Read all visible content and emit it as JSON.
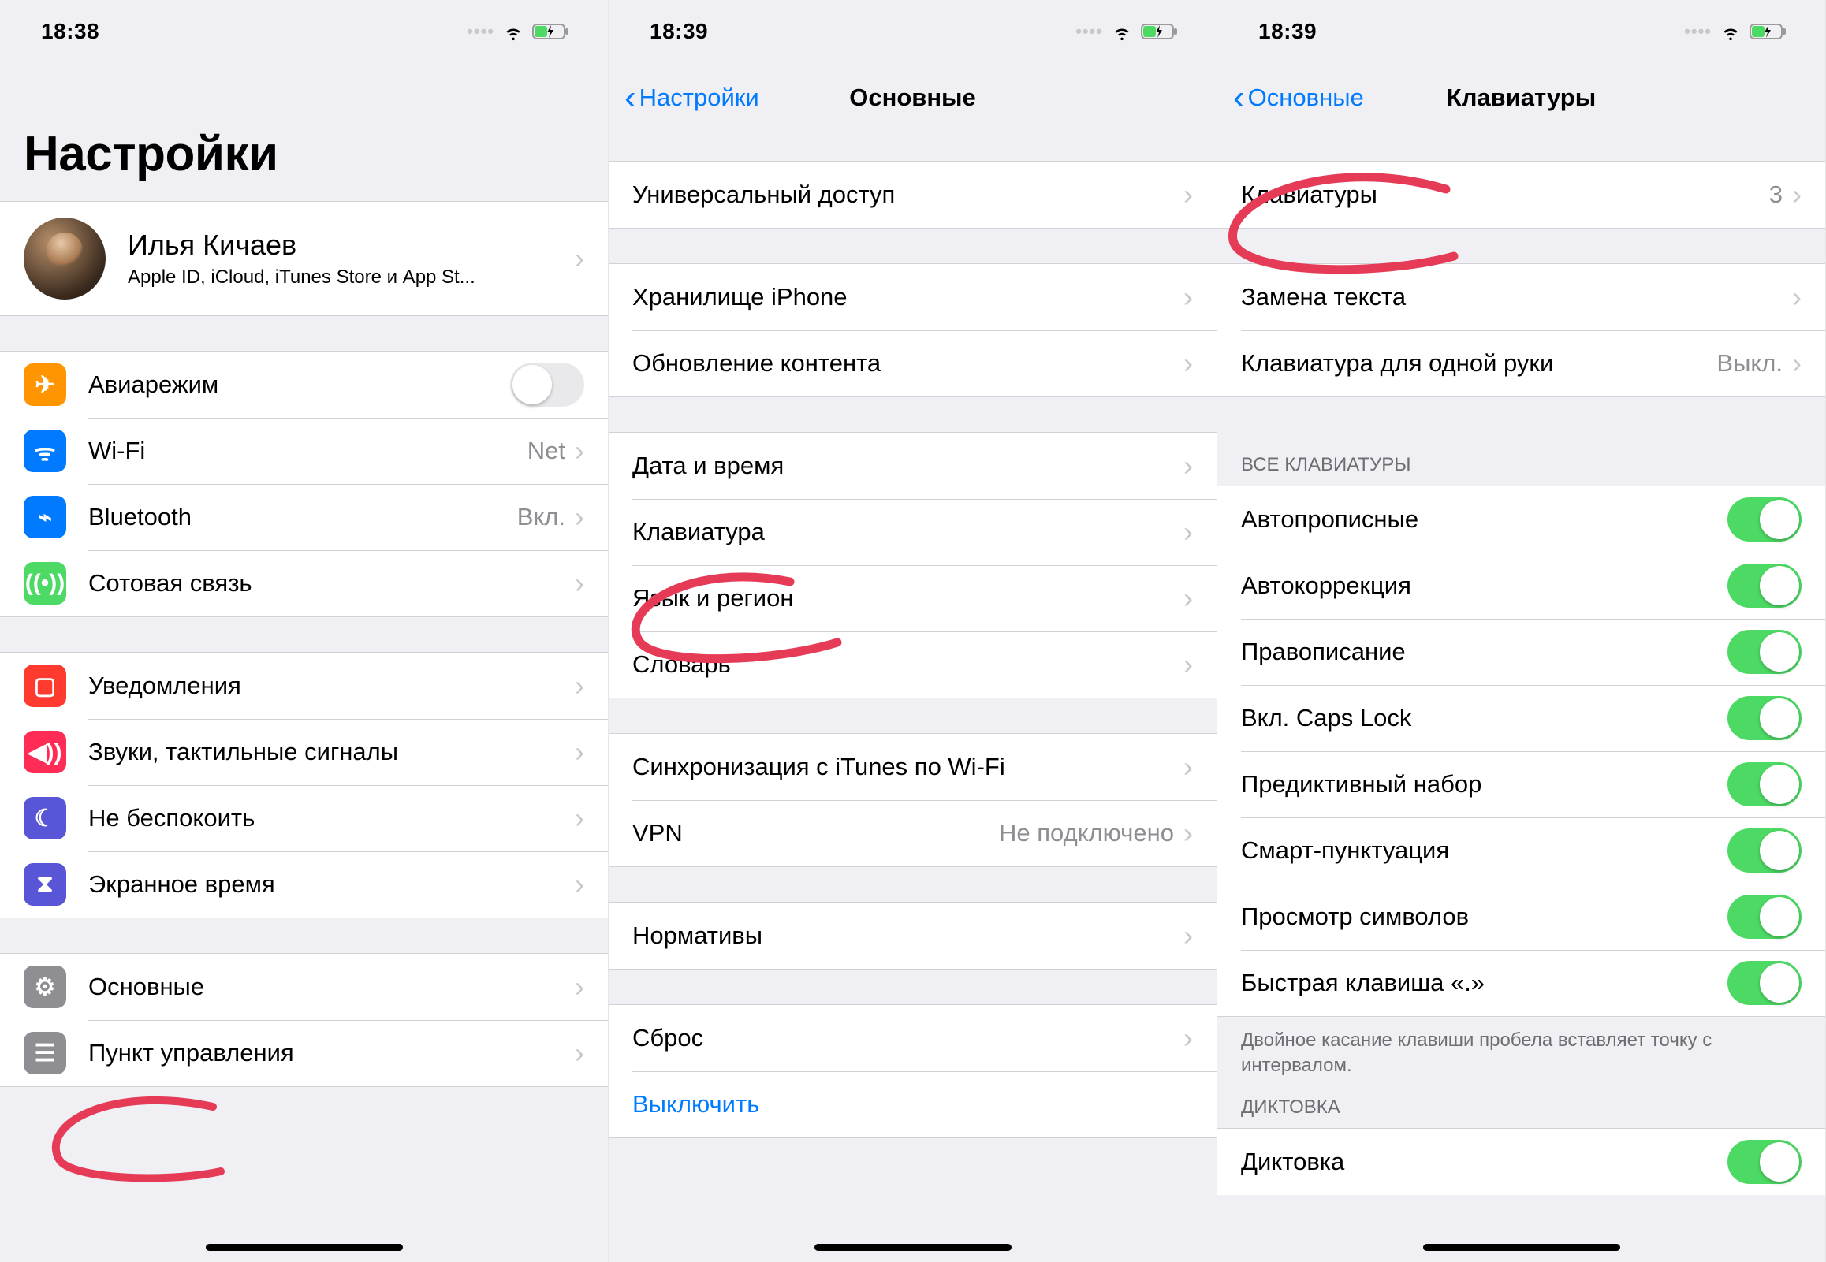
{
  "screen1": {
    "time": "18:38",
    "title": "Настройки",
    "profile": {
      "name": "Илья Кичаев",
      "sub": "Apple ID, iCloud, iTunes Store и App St..."
    },
    "rows_a": [
      {
        "icon": "airplane",
        "color": "ic-orange",
        "label": "Авиарежим",
        "type": "switch",
        "on": false
      },
      {
        "icon": "wifi",
        "color": "ic-blue",
        "label": "Wi-Fi",
        "value": "Net",
        "type": "link"
      },
      {
        "icon": "bluetooth",
        "color": "ic-blue",
        "label": "Bluetooth",
        "value": "Вкл.",
        "type": "link"
      },
      {
        "icon": "cellular",
        "color": "ic-green",
        "label": "Сотовая связь",
        "type": "link"
      }
    ],
    "rows_b": [
      {
        "icon": "bell",
        "color": "ic-red",
        "label": "Уведомления",
        "type": "link"
      },
      {
        "icon": "sound",
        "color": "ic-pink",
        "label": "Звуки, тактильные сигналы",
        "type": "link"
      },
      {
        "icon": "moon",
        "color": "ic-indigo",
        "label": "Не беспокоить",
        "type": "link"
      },
      {
        "icon": "hourglass",
        "color": "ic-indigo",
        "label": "Экранное время",
        "type": "link"
      }
    ],
    "rows_c": [
      {
        "icon": "gear",
        "color": "ic-gray",
        "label": "Основные",
        "type": "link"
      },
      {
        "icon": "sliders",
        "color": "ic-gray",
        "label": "Пункт управления",
        "type": "link"
      }
    ]
  },
  "screen2": {
    "time": "18:39",
    "back": "Настройки",
    "title": "Основные",
    "groups": [
      [
        {
          "label": "Универсальный доступ"
        }
      ],
      [
        {
          "label": "Хранилище iPhone"
        },
        {
          "label": "Обновление контента"
        }
      ],
      [
        {
          "label": "Дата и время"
        },
        {
          "label": "Клавиатура"
        },
        {
          "label": "Язык и регион"
        },
        {
          "label": "Словарь"
        }
      ],
      [
        {
          "label": "Синхронизация с iTunes по Wi-Fi"
        },
        {
          "label": "VPN",
          "value": "Не подключено"
        }
      ],
      [
        {
          "label": "Нормативы"
        }
      ],
      [
        {
          "label": "Сброс"
        },
        {
          "label": "Выключить",
          "blue": true
        }
      ]
    ]
  },
  "screen3": {
    "time": "18:39",
    "back": "Основные",
    "title": "Клавиатуры",
    "rows_top": [
      {
        "label": "Клавиатуры",
        "value": "3"
      }
    ],
    "rows_mid": [
      {
        "label": "Замена текста"
      },
      {
        "label": "Клавиатура для одной руки",
        "value": "Выкл."
      }
    ],
    "section_header": "ВСЕ КЛАВИАТУРЫ",
    "toggles": [
      {
        "label": "Автопрописные",
        "on": true
      },
      {
        "label": "Автокоррекция",
        "on": true
      },
      {
        "label": "Правописание",
        "on": true
      },
      {
        "label": "Вкл. Caps Lock",
        "on": true
      },
      {
        "label": "Предиктивный набор",
        "on": true
      },
      {
        "label": "Смарт-пунктуация",
        "on": true
      },
      {
        "label": "Просмотр символов",
        "on": true
      },
      {
        "label": "Быстрая клавиша «.»",
        "on": true
      }
    ],
    "footer": "Двойное касание клавиши пробела вставляет точку с интервалом.",
    "section_header2": "ДИКТОВКА",
    "dictation": {
      "label": "Диктовка",
      "on": true
    }
  }
}
